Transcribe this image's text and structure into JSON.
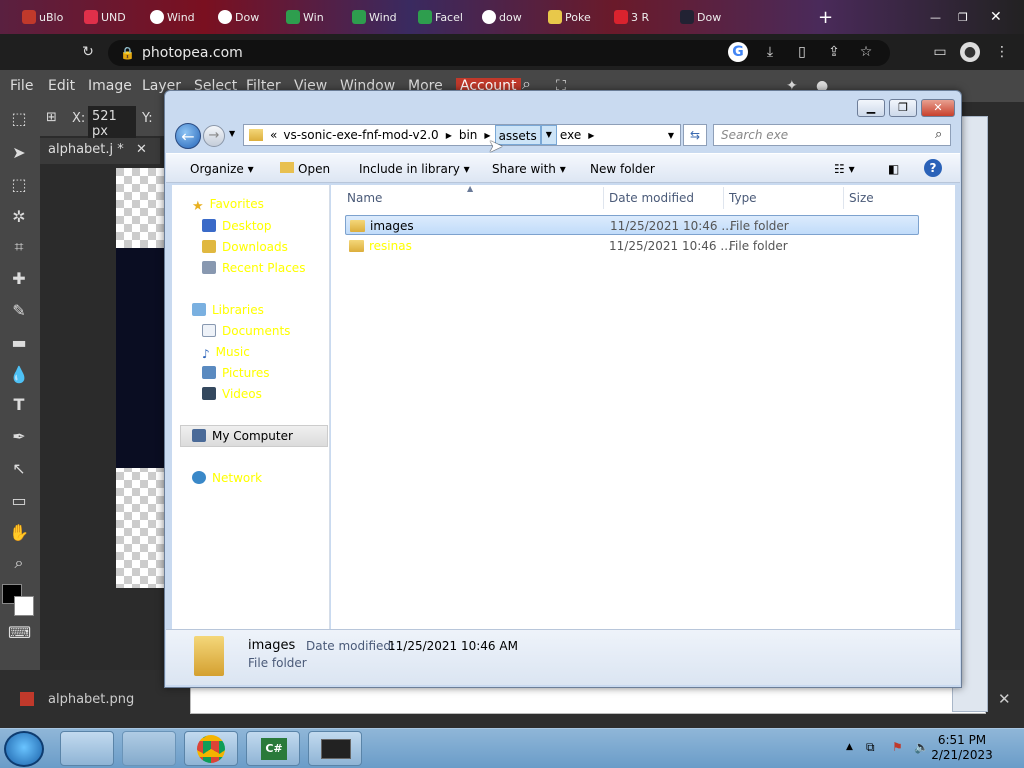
{
  "browser": {
    "tabs": [
      {
        "label": "uBlo"
      },
      {
        "label": "UND"
      },
      {
        "label": "Wind"
      },
      {
        "label": "Dow"
      },
      {
        "label": "Win"
      },
      {
        "label": "Wind"
      },
      {
        "label": "Facel"
      },
      {
        "label": "dow"
      },
      {
        "label": "Poke"
      },
      {
        "label": "3 R"
      },
      {
        "label": "Dow"
      }
    ],
    "url": "photopea.com"
  },
  "photopea": {
    "menu": [
      "File",
      "Edit",
      "Image",
      "Layer",
      "Select",
      "Filter",
      "View",
      "Window",
      "More",
      "Account"
    ],
    "x_label": "X:",
    "x_value": "521 px",
    "y_label": "Y:",
    "doc_tab": "alphabet.j",
    "doc_tab_modified": "*",
    "bottom_file": "alphabet.png"
  },
  "explorer": {
    "breadcrumb": {
      "overflow": "«",
      "parts": [
        "vs-sonic-exe-fnf-mod-v2.0",
        "bin",
        "assets",
        "exe"
      ]
    },
    "search_placeholder": "Search exe",
    "commands": {
      "organize": "Organize",
      "open": "Open",
      "include": "Include in library",
      "share": "Share with",
      "new_folder": "New folder"
    },
    "nav": {
      "favorites": "Favorites",
      "desktop": "Desktop",
      "downloads": "Downloads",
      "recent": "Recent Places",
      "libraries": "Libraries",
      "documents": "Documents",
      "music": "Music",
      "pictures": "Pictures",
      "videos": "Videos",
      "computer": "My Computer",
      "network": "Network"
    },
    "columns": {
      "name": "Name",
      "date": "Date modified",
      "type": "Type",
      "size": "Size"
    },
    "files": [
      {
        "name": "images",
        "date": "11/25/2021 10:46 ...",
        "type": "File folder",
        "selected": true
      },
      {
        "name": "resinas",
        "date": "11/25/2021 10:46 ...",
        "type": "File folder",
        "selected": false
      }
    ],
    "details": {
      "name": "images",
      "date_label": "Date modified:",
      "date_value": "11/25/2021 10:46 AM",
      "type": "File folder"
    }
  },
  "taskbar": {
    "time": "6:51 PM",
    "date": "2/21/2023"
  },
  "colors": {
    "nav_text": "#ffff00",
    "selection": "#cce4f7",
    "accent": "#3399ff"
  }
}
